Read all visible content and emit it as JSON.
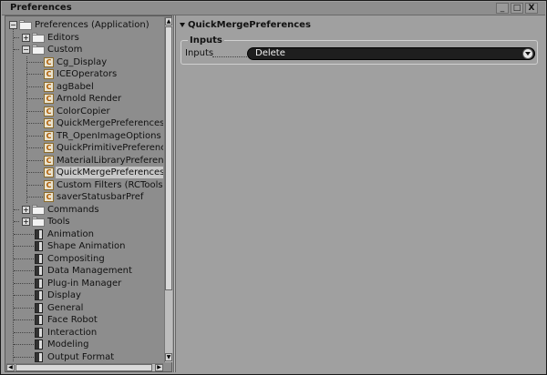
{
  "window": {
    "title": "Preferences",
    "buttons": {
      "minimize": "_",
      "maximize": "□",
      "close": "X"
    }
  },
  "tree": {
    "root": "Preferences (Application)",
    "nodes": [
      {
        "label": "Editors",
        "icon": "folder-icon",
        "expander": "+"
      },
      {
        "label": "Custom",
        "icon": "folder-icon",
        "expander": "−"
      },
      {
        "label": "Cg_Display",
        "icon": "custom-pref-icon"
      },
      {
        "label": "ICEOperators",
        "icon": "custom-pref-icon"
      },
      {
        "label": "agBabel",
        "icon": "custom-pref-icon"
      },
      {
        "label": "Arnold Render",
        "icon": "custom-pref-icon"
      },
      {
        "label": "ColorCopier",
        "icon": "custom-pref-icon"
      },
      {
        "label": "QuickMergePreferences",
        "icon": "custom-pref-icon"
      },
      {
        "label": "TR_OpenImageOptions",
        "icon": "custom-pref-icon"
      },
      {
        "label": "QuickPrimitivePreferences",
        "icon": "custom-pref-icon"
      },
      {
        "label": "MaterialLibraryPreferences",
        "icon": "custom-pref-icon"
      },
      {
        "label": "QuickMergePreferences",
        "icon": "custom-pref-icon",
        "selected": true
      },
      {
        "label": "Custom Filters (RCTools)",
        "icon": "custom-pref-icon"
      },
      {
        "label": "saverStatusbarPref",
        "icon": "custom-pref-icon"
      },
      {
        "label": "Commands",
        "icon": "folder-icon",
        "expander": "+"
      },
      {
        "label": "Tools",
        "icon": "folder-icon",
        "expander": "+"
      },
      {
        "label": "Animation",
        "icon": "pref-page-icon"
      },
      {
        "label": "Shape Animation",
        "icon": "pref-page-icon"
      },
      {
        "label": "Compositing",
        "icon": "pref-page-icon"
      },
      {
        "label": "Data Management",
        "icon": "pref-page-icon"
      },
      {
        "label": "Plug-in Manager",
        "icon": "pref-page-icon"
      },
      {
        "label": "Display",
        "icon": "pref-page-icon"
      },
      {
        "label": "General",
        "icon": "pref-page-icon"
      },
      {
        "label": "Face Robot",
        "icon": "pref-page-icon"
      },
      {
        "label": "Interaction",
        "icon": "pref-page-icon"
      },
      {
        "label": "Modeling",
        "icon": "pref-page-icon"
      },
      {
        "label": "Output Format",
        "icon": "pref-page-icon"
      }
    ]
  },
  "property_panel": {
    "section_title": "QuickMergePreferences",
    "group_title": "Inputs",
    "field_label": "Inputs",
    "field_value": "Delete"
  }
}
